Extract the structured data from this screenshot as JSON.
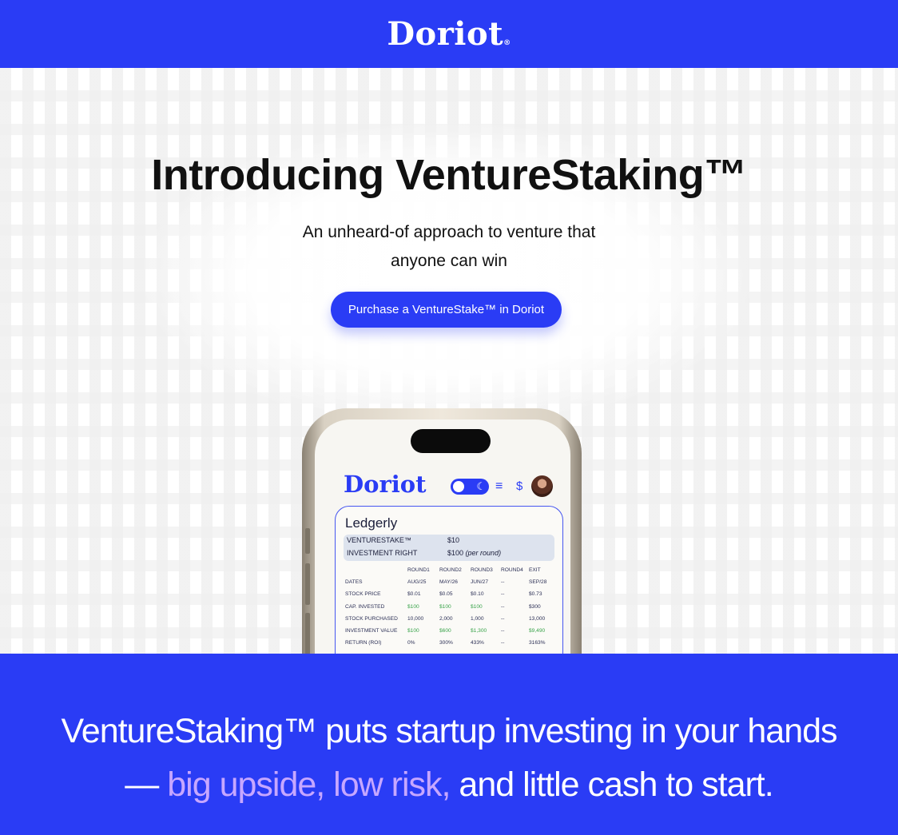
{
  "header": {
    "logo_text": "Doriot",
    "logo_mark": "®"
  },
  "hero": {
    "title": "Introducing VentureStaking™",
    "subtitle": "An unheard-of approach to venture that anyone can win",
    "cta_label": "Purchase a VentureStake™ in Doriot"
  },
  "phone": {
    "app_logo": "Doriot",
    "icons": [
      "toggle-theme-icon",
      "moon-icon",
      "menu-icon",
      "dollar-icon",
      "avatar"
    ],
    "dollar_glyph": "$",
    "moon_glyph": "☾",
    "menu_glyph": "≡",
    "card": {
      "title": "Ledgerly",
      "venturestake_label": "VENTURESTAKE™",
      "venturestake_value": "$10",
      "investment_right_label": "INVESTMENT RIGHT",
      "investment_right_value": "$100",
      "investment_right_note": "(per round)",
      "columns": [
        "",
        "ROUND1",
        "ROUND2",
        "ROUND3",
        "ROUND4",
        "EXIT"
      ],
      "rows": [
        [
          "DATES",
          "AUG/25",
          "MAY/26",
          "JUN/27",
          "--",
          "SEP/28"
        ],
        [
          "STOCK PRICE",
          "$0.01",
          "$0.05",
          "$0.10",
          "--",
          "$0.73"
        ],
        [
          "CAP. INVESTED",
          "$100",
          "$100",
          "$100",
          "--",
          "$300"
        ],
        [
          "STOCK PURCHASED",
          "10,000",
          "2,000",
          "1,000",
          "--",
          "13,000"
        ],
        [
          "INVESTMENT VALUE",
          "$100",
          "$600",
          "$1,300",
          "--",
          "$9,490"
        ],
        [
          "RETURN (ROI)",
          "0%",
          "300%",
          "433%",
          "--",
          "3163%"
        ]
      ]
    }
  },
  "band": {
    "line1": "VentureStaking™ puts startup investing in your hands",
    "line2_prefix": "— ",
    "line2_accent": "big upside, low risk,",
    "line2_rest": " and little cash to start."
  },
  "colors": {
    "brand_blue": "#2a3cf5",
    "accent_lilac": "#c7a7ff",
    "positive_green": "#39a34a"
  }
}
